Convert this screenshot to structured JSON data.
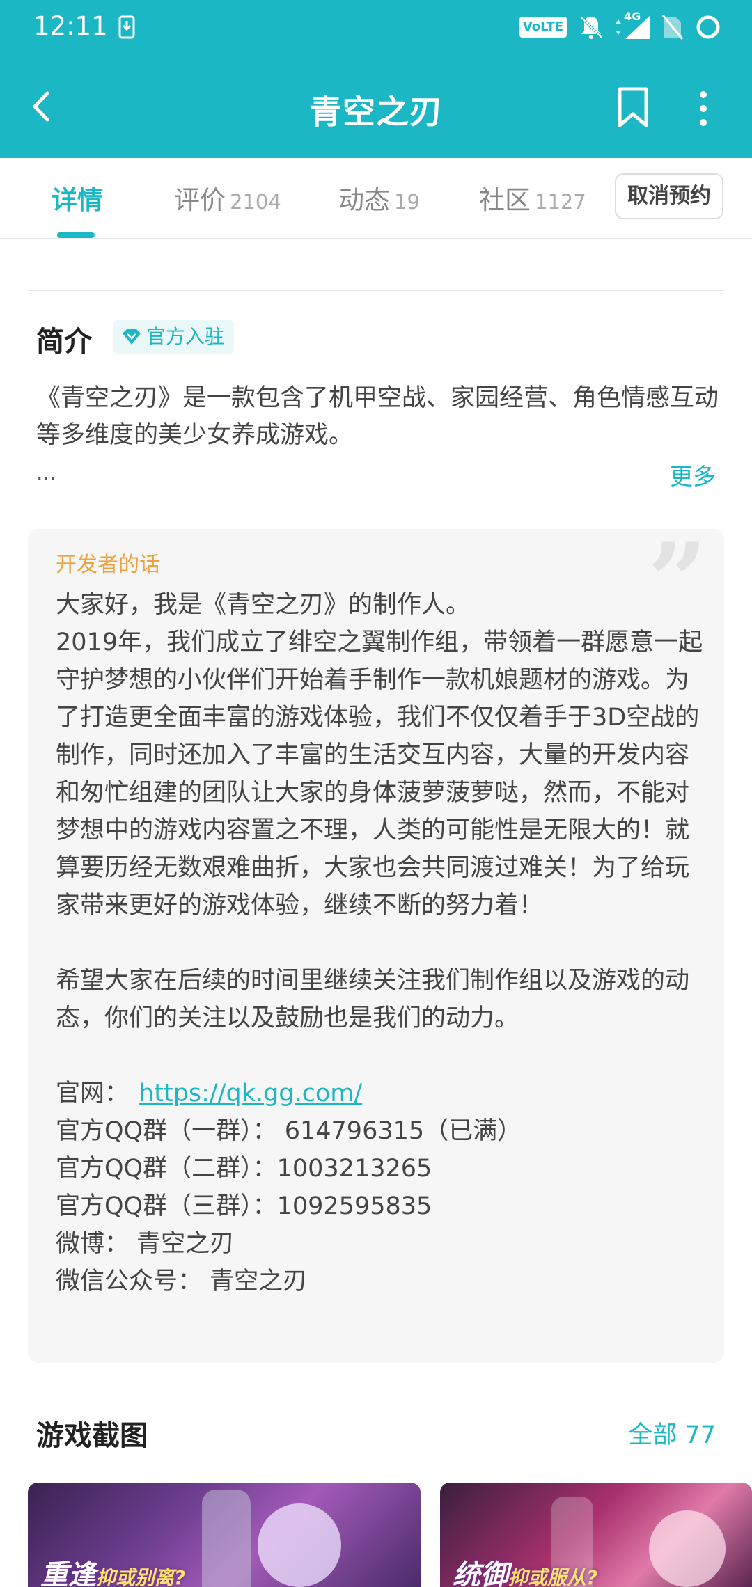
{
  "status_bar": {
    "time": "12:11",
    "volte": "VoLTE",
    "network": "4G"
  },
  "app_bar": {
    "title": "青空之刃"
  },
  "tabs": [
    {
      "label": "详情",
      "count": ""
    },
    {
      "label": "评价",
      "count": "2104"
    },
    {
      "label": "动态",
      "count": "19"
    },
    {
      "label": "社区",
      "count": "1127"
    }
  ],
  "reserve_button": "取消预约",
  "intro": {
    "title": "简介",
    "badge": "官方入驻",
    "text": "《青空之刃》是一款包含了机甲空战、家园经营、角色情感互动等多维度的美少女养成游戏。",
    "ellipsis": "...",
    "more": "更多"
  },
  "developer": {
    "label": "开发者的话",
    "paragraph1": "大家好，我是《青空之刃》的制作人。\n2019年，我们成立了绯空之翼制作组，带领着一群愿意一起守护梦想的小伙伴们开始着手制作一款机娘题材的游戏。为了打造更全面丰富的游戏体验，我们不仅仅着手于3D空战的制作，同时还加入了丰富的生活交互内容，大量的开发内容和匆忙组建的团队让大家的身体菠萝菠萝哒，然而，不能对梦想中的游戏内容置之不理，人类的可能性是无限大的！就算要历经无数艰难曲折，大家也会共同渡过难关！为了给玩家带来更好的游戏体验，继续不断的努力着！",
    "paragraph2": "希望大家在后续的时间里继续关注我们制作组以及游戏的动态，你们的关注以及鼓励也是我们的动力。",
    "website_label": "官网：",
    "website_url": "https://qk.gg.com/",
    "qq1": "官方QQ群（一群）： 614796315（已满）",
    "qq2": "官方QQ群（二群）：1003213265",
    "qq3": "官方QQ群（三群）：1092595835",
    "weibo": "微博： 青空之刃",
    "wechat": "微信公众号： 青空之刃"
  },
  "screenshots": {
    "title": "游戏截图",
    "all": "全部 77",
    "items": [
      {
        "caption_main": "重逢",
        "caption_sub": "抑或别离?"
      },
      {
        "caption_main": "统御",
        "caption_sub": "抑或服从?"
      }
    ]
  },
  "colors": {
    "accent": "#1bb7c4",
    "developer_label": "#f0a13c"
  }
}
